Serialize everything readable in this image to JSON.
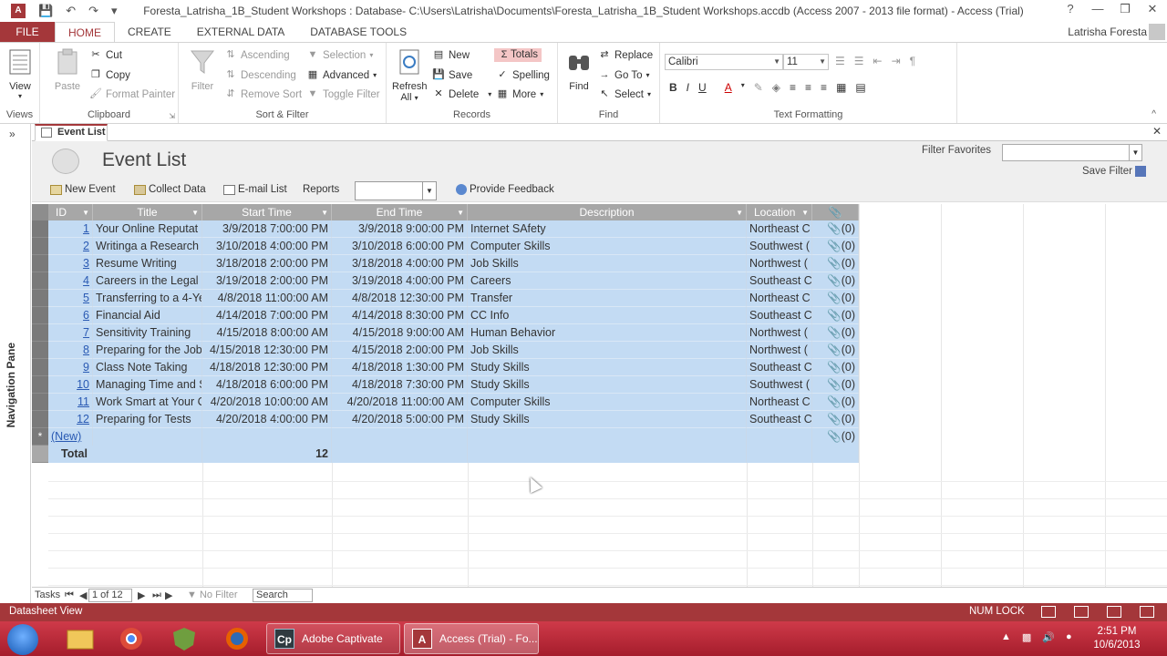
{
  "window": {
    "title": "Foresta_Latrisha_1B_Student Workshops : Database- C:\\Users\\Latrisha\\Documents\\Foresta_Latrisha_1B_Student Workshops.accdb (Access 2007 - 2013 file format) - Access (Trial)",
    "app_icon": "A",
    "help": "?",
    "minimize": "—",
    "restore": "❒",
    "close": "✕"
  },
  "ribbon_tabs": [
    "FILE",
    "HOME",
    "CREATE",
    "EXTERNAL DATA",
    "DATABASE TOOLS"
  ],
  "user_name": "Latrisha Foresta",
  "ribbon": {
    "views": {
      "view": "View",
      "label": "Views"
    },
    "clipboard": {
      "paste": "Paste",
      "cut": "Cut",
      "copy": "Copy",
      "format_painter": "Format Painter",
      "label": "Clipboard"
    },
    "sort_filter": {
      "filter": "Filter",
      "ascending": "Ascending",
      "descending": "Descending",
      "remove_sort": "Remove Sort",
      "selection": "Selection",
      "advanced": "Advanced",
      "toggle_filter": "Toggle Filter",
      "label": "Sort & Filter"
    },
    "records": {
      "refresh": "Refresh",
      "refresh_all": "All",
      "new": "New",
      "save": "Save",
      "delete": "Delete",
      "totals": "Totals",
      "spelling": "Spelling",
      "more": "More",
      "label": "Records"
    },
    "find": {
      "find": "Find",
      "replace": "Replace",
      "go_to": "Go To",
      "select": "Select",
      "label": "Find"
    },
    "text_formatting": {
      "font": "Calibri",
      "size": "11",
      "bold": "B",
      "italic": "I",
      "underline": "U",
      "label": "Text Formatting"
    }
  },
  "nav_pane_label": "Navigation Pane",
  "doc_tab": "Event List",
  "form": {
    "title": "Event List",
    "filter_favorites_label": "Filter Favorites",
    "save_filter": "Save Filter",
    "toolbar": [
      "New Event",
      "Collect Data",
      "E-mail List",
      "Reports",
      "Provide Feedback"
    ]
  },
  "datasheet": {
    "columns": [
      "ID",
      "Title",
      "Start Time",
      "End Time",
      "Description",
      "Location"
    ],
    "attach_header": "@",
    "rows": [
      [
        "1",
        "Your Online Reputat",
        "3/9/2018 7:00:00 PM",
        "3/9/2018 9:00:00 PM",
        "Internet SAfety",
        "Northeast C",
        "(0)"
      ],
      [
        "2",
        "Writinga a Research",
        "3/10/2018 4:00:00 PM",
        "3/10/2018 6:00:00 PM",
        "Computer Skills",
        "Southwest (",
        "(0)"
      ],
      [
        "3",
        "Resume Writing",
        "3/18/2018 2:00:00 PM",
        "3/18/2018 4:00:00 PM",
        "Job Skills",
        "Northwest (",
        "(0)"
      ],
      [
        "4",
        "Careers in the Legal I",
        "3/19/2018 2:00:00 PM",
        "3/19/2018 4:00:00 PM",
        "Careers",
        "Southeast C",
        "(0)"
      ],
      [
        "5",
        "Transferring to a 4-Ye",
        "4/8/2018 11:00:00 AM",
        "4/8/2018 12:30:00 PM",
        "Transfer",
        "Northeast C",
        "(0)"
      ],
      [
        "6",
        "Financial Aid",
        "4/14/2018 7:00:00 PM",
        "4/14/2018 8:30:00 PM",
        "CC Info",
        "Southeast C",
        "(0)"
      ],
      [
        "7",
        "Sensitivity Training",
        "4/15/2018 8:00:00 AM",
        "4/15/2018 9:00:00 AM",
        "Human Behavior",
        "Northwest (",
        "(0)"
      ],
      [
        "8",
        "Preparing for the Job",
        "4/15/2018 12:30:00 PM",
        "4/15/2018 2:00:00 PM",
        "Job Skills",
        "Northwest (",
        "(0)"
      ],
      [
        "9",
        "Class Note Taking",
        "4/18/2018 12:30:00 PM",
        "4/18/2018 1:30:00 PM",
        "Study Skills",
        "Southeast C",
        "(0)"
      ],
      [
        "10",
        "Managing Time and S",
        "4/18/2018 6:00:00 PM",
        "4/18/2018 7:30:00 PM",
        "Study Skills",
        "Southwest (",
        "(0)"
      ],
      [
        "11",
        "Work Smart at Your C",
        "4/20/2018 10:00:00 AM",
        "4/20/2018 11:00:00 AM",
        "Computer Skills",
        "Northeast C",
        "(0)"
      ],
      [
        "12",
        "Preparing for Tests",
        "4/20/2018 4:00:00 PM",
        "4/20/2018 5:00:00 PM",
        "Study Skills",
        "Southeast C",
        "(0)"
      ]
    ],
    "new_row_label": "(New)",
    "new_row_attach": "(0)",
    "new_row_marker": "*",
    "total_label": "Total",
    "total_value": "12"
  },
  "record_nav": {
    "tasks": "Tasks",
    "position": "1 of 12",
    "no_filter": "No Filter",
    "search": "Search"
  },
  "status": {
    "view": "Datasheet View",
    "num_lock": "NUM LOCK"
  },
  "taskbar": {
    "tasks": [
      "Adobe Captivate",
      "Access (Trial) - Fo..."
    ],
    "time": "2:51 PM",
    "date": "10/6/2013"
  },
  "colors": {
    "accent": "#a4373a",
    "selection": "#c3dbf3",
    "header": "#a7a7a7"
  }
}
